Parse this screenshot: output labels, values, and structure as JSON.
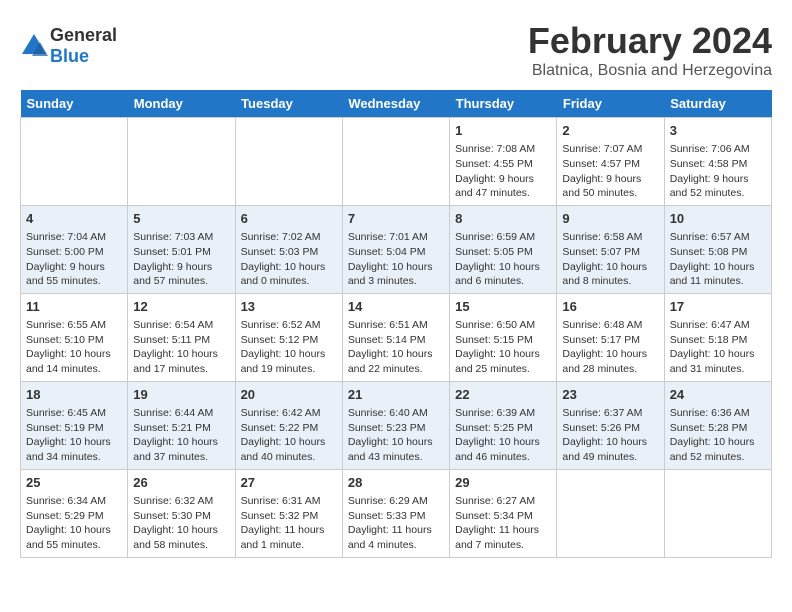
{
  "header": {
    "logo_general": "General",
    "logo_blue": "Blue",
    "title": "February 2024",
    "subtitle": "Blatnica, Bosnia and Herzegovina"
  },
  "days_of_week": [
    "Sunday",
    "Monday",
    "Tuesday",
    "Wednesday",
    "Thursday",
    "Friday",
    "Saturday"
  ],
  "weeks": [
    [
      {
        "date": "",
        "content": ""
      },
      {
        "date": "",
        "content": ""
      },
      {
        "date": "",
        "content": ""
      },
      {
        "date": "",
        "content": ""
      },
      {
        "date": "1",
        "content": "Sunrise: 7:08 AM\nSunset: 4:55 PM\nDaylight: 9 hours\nand 47 minutes."
      },
      {
        "date": "2",
        "content": "Sunrise: 7:07 AM\nSunset: 4:57 PM\nDaylight: 9 hours\nand 50 minutes."
      },
      {
        "date": "3",
        "content": "Sunrise: 7:06 AM\nSunset: 4:58 PM\nDaylight: 9 hours\nand 52 minutes."
      }
    ],
    [
      {
        "date": "4",
        "content": "Sunrise: 7:04 AM\nSunset: 5:00 PM\nDaylight: 9 hours\nand 55 minutes."
      },
      {
        "date": "5",
        "content": "Sunrise: 7:03 AM\nSunset: 5:01 PM\nDaylight: 9 hours\nand 57 minutes."
      },
      {
        "date": "6",
        "content": "Sunrise: 7:02 AM\nSunset: 5:03 PM\nDaylight: 10 hours\nand 0 minutes."
      },
      {
        "date": "7",
        "content": "Sunrise: 7:01 AM\nSunset: 5:04 PM\nDaylight: 10 hours\nand 3 minutes."
      },
      {
        "date": "8",
        "content": "Sunrise: 6:59 AM\nSunset: 5:05 PM\nDaylight: 10 hours\nand 6 minutes."
      },
      {
        "date": "9",
        "content": "Sunrise: 6:58 AM\nSunset: 5:07 PM\nDaylight: 10 hours\nand 8 minutes."
      },
      {
        "date": "10",
        "content": "Sunrise: 6:57 AM\nSunset: 5:08 PM\nDaylight: 10 hours\nand 11 minutes."
      }
    ],
    [
      {
        "date": "11",
        "content": "Sunrise: 6:55 AM\nSunset: 5:10 PM\nDaylight: 10 hours\nand 14 minutes."
      },
      {
        "date": "12",
        "content": "Sunrise: 6:54 AM\nSunset: 5:11 PM\nDaylight: 10 hours\nand 17 minutes."
      },
      {
        "date": "13",
        "content": "Sunrise: 6:52 AM\nSunset: 5:12 PM\nDaylight: 10 hours\nand 19 minutes."
      },
      {
        "date": "14",
        "content": "Sunrise: 6:51 AM\nSunset: 5:14 PM\nDaylight: 10 hours\nand 22 minutes."
      },
      {
        "date": "15",
        "content": "Sunrise: 6:50 AM\nSunset: 5:15 PM\nDaylight: 10 hours\nand 25 minutes."
      },
      {
        "date": "16",
        "content": "Sunrise: 6:48 AM\nSunset: 5:17 PM\nDaylight: 10 hours\nand 28 minutes."
      },
      {
        "date": "17",
        "content": "Sunrise: 6:47 AM\nSunset: 5:18 PM\nDaylight: 10 hours\nand 31 minutes."
      }
    ],
    [
      {
        "date": "18",
        "content": "Sunrise: 6:45 AM\nSunset: 5:19 PM\nDaylight: 10 hours\nand 34 minutes."
      },
      {
        "date": "19",
        "content": "Sunrise: 6:44 AM\nSunset: 5:21 PM\nDaylight: 10 hours\nand 37 minutes."
      },
      {
        "date": "20",
        "content": "Sunrise: 6:42 AM\nSunset: 5:22 PM\nDaylight: 10 hours\nand 40 minutes."
      },
      {
        "date": "21",
        "content": "Sunrise: 6:40 AM\nSunset: 5:23 PM\nDaylight: 10 hours\nand 43 minutes."
      },
      {
        "date": "22",
        "content": "Sunrise: 6:39 AM\nSunset: 5:25 PM\nDaylight: 10 hours\nand 46 minutes."
      },
      {
        "date": "23",
        "content": "Sunrise: 6:37 AM\nSunset: 5:26 PM\nDaylight: 10 hours\nand 49 minutes."
      },
      {
        "date": "24",
        "content": "Sunrise: 6:36 AM\nSunset: 5:28 PM\nDaylight: 10 hours\nand 52 minutes."
      }
    ],
    [
      {
        "date": "25",
        "content": "Sunrise: 6:34 AM\nSunset: 5:29 PM\nDaylight: 10 hours\nand 55 minutes."
      },
      {
        "date": "26",
        "content": "Sunrise: 6:32 AM\nSunset: 5:30 PM\nDaylight: 10 hours\nand 58 minutes."
      },
      {
        "date": "27",
        "content": "Sunrise: 6:31 AM\nSunset: 5:32 PM\nDaylight: 11 hours\nand 1 minute."
      },
      {
        "date": "28",
        "content": "Sunrise: 6:29 AM\nSunset: 5:33 PM\nDaylight: 11 hours\nand 4 minutes."
      },
      {
        "date": "29",
        "content": "Sunrise: 6:27 AM\nSunset: 5:34 PM\nDaylight: 11 hours\nand 7 minutes."
      },
      {
        "date": "",
        "content": ""
      },
      {
        "date": "",
        "content": ""
      }
    ]
  ]
}
